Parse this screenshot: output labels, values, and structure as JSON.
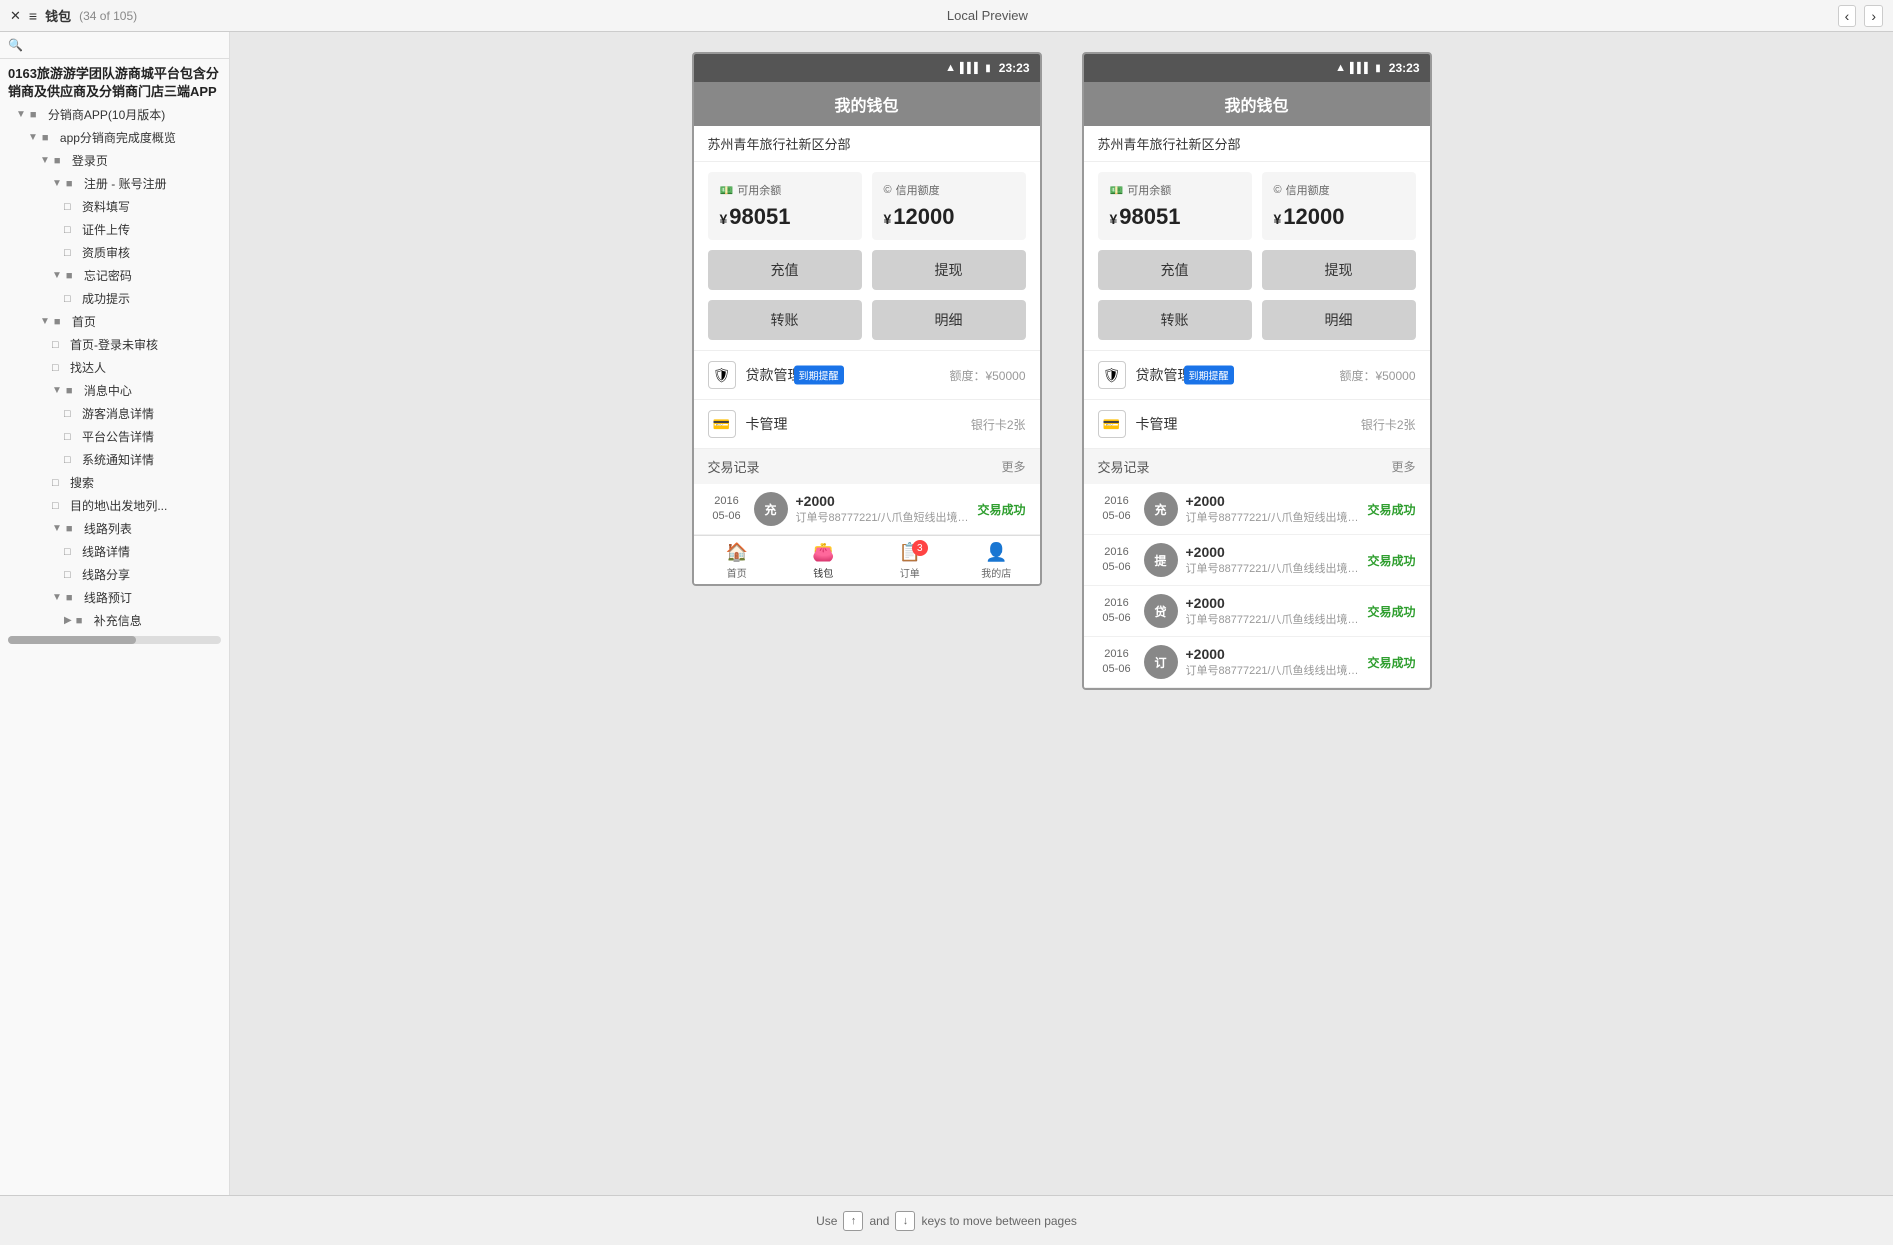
{
  "topBar": {
    "icon": "≡",
    "title": "钱包",
    "count": "(34 of 105)",
    "previewLabel": "Local Preview",
    "navPrev": "‹",
    "navNext": "›"
  },
  "sidebar": {
    "searchPlaceholder": "",
    "headerText": "0163旅游游学团队游商城平台包含分销商及供应商及分销商门店三端APP",
    "items": [
      {
        "level": 1,
        "type": "expand",
        "label": "分销商APP(10月版本)",
        "hasArrow": true
      },
      {
        "level": 2,
        "type": "expand",
        "label": "app分销商完成度概览",
        "hasArrow": true
      },
      {
        "level": 3,
        "type": "expand",
        "label": "登录页",
        "hasArrow": true
      },
      {
        "level": 4,
        "type": "expand",
        "label": "注册 - 账号注册",
        "hasArrow": true
      },
      {
        "level": 5,
        "type": "item",
        "label": "资料填写"
      },
      {
        "level": 5,
        "type": "item",
        "label": "证件上传"
      },
      {
        "level": 5,
        "type": "item",
        "label": "资质审核"
      },
      {
        "level": 4,
        "type": "expand",
        "label": "忘记密码",
        "hasArrow": true
      },
      {
        "level": 5,
        "type": "item",
        "label": "成功提示"
      },
      {
        "level": 3,
        "type": "expand",
        "label": "首页",
        "hasArrow": true
      },
      {
        "level": 4,
        "type": "item",
        "label": "首页-登录未审核"
      },
      {
        "level": 4,
        "type": "item",
        "label": "找达人"
      },
      {
        "level": 4,
        "type": "expand",
        "label": "消息中心",
        "hasArrow": true
      },
      {
        "level": 5,
        "type": "item",
        "label": "游客消息详情"
      },
      {
        "level": 5,
        "type": "item",
        "label": "平台公告详情"
      },
      {
        "level": 5,
        "type": "item",
        "label": "系统通知详情"
      },
      {
        "level": 4,
        "type": "item",
        "label": "搜索"
      },
      {
        "level": 4,
        "type": "item",
        "label": "目的地\\出发地列..."
      },
      {
        "level": 4,
        "type": "expand",
        "label": "线路列表",
        "hasArrow": true
      },
      {
        "level": 5,
        "type": "item",
        "label": "线路详情"
      },
      {
        "level": 5,
        "type": "item",
        "label": "线路分享"
      },
      {
        "level": 4,
        "type": "expand",
        "label": "线路预订",
        "hasArrow": true
      },
      {
        "level": 5,
        "type": "expand",
        "label": "补充信息",
        "hasArrow": true
      }
    ]
  },
  "phoneLeft": {
    "statusBar": {
      "wifi": "wifi",
      "signal": "signal",
      "battery": "battery",
      "time": "23:23"
    },
    "header": "我的钱包",
    "agencyName": "苏州青年旅行社新区分部",
    "balances": [
      {
        "icon": "💵",
        "title": "可用余额",
        "amount": "98051"
      },
      {
        "icon": "💳",
        "title": "信用额度",
        "amount": "12000"
      }
    ],
    "actionRow1": [
      {
        "label": "充值"
      },
      {
        "label": "提现"
      }
    ],
    "actionRow2": [
      {
        "label": "转账"
      },
      {
        "label": "明细"
      }
    ],
    "menuItems": [
      {
        "icon": "🛡",
        "label": "贷款管理",
        "badge": "到期提醒",
        "right": "额度：¥50000"
      },
      {
        "icon": "💳",
        "label": "卡管理",
        "badge": null,
        "right": "银行卡2张"
      }
    ],
    "txHeader": {
      "title": "交易记录",
      "more": "更多"
    },
    "transactions": [
      {
        "year": "2016",
        "date": "05-06",
        "circleLabel": "充",
        "amount": "+2000",
        "desc": "订单号88777221/八爪鱼短线出境订单...",
        "status": "交易成功"
      },
      {
        "year": "",
        "date": "",
        "circleLabel": "",
        "amount": "",
        "desc": "",
        "status": ""
      }
    ],
    "bottomNav": [
      {
        "icon": "🏠",
        "label": "首页",
        "active": false,
        "badge": null
      },
      {
        "icon": "👛",
        "label": "钱包",
        "active": true,
        "badge": null
      },
      {
        "icon": "📋",
        "label": "订单",
        "active": false,
        "badge": "3"
      },
      {
        "icon": "👤",
        "label": "我的店",
        "active": false,
        "badge": null
      }
    ]
  },
  "phoneRight": {
    "statusBar": {
      "wifi": "wifi",
      "signal": "signal",
      "battery": "battery",
      "time": "23:23"
    },
    "header": "我的钱包",
    "agencyName": "苏州青年旅行社新区分部",
    "balances": [
      {
        "icon": "💵",
        "title": "可用余额",
        "amount": "98051"
      },
      {
        "icon": "💳",
        "title": "信用额度",
        "amount": "12000"
      }
    ],
    "actionRow1": [
      {
        "label": "充值"
      },
      {
        "label": "提现"
      }
    ],
    "actionRow2": [
      {
        "label": "转账"
      },
      {
        "label": "明细"
      }
    ],
    "menuItems": [
      {
        "icon": "🛡",
        "label": "贷款管理",
        "badge": "到期提醒",
        "right": "额度：¥50000"
      },
      {
        "icon": "💳",
        "label": "卡管理",
        "badge": null,
        "right": "银行卡2张"
      }
    ],
    "txHeader": {
      "title": "交易记录",
      "more": "更多"
    },
    "transactions": [
      {
        "year": "2016",
        "date": "05-06",
        "circleLabel": "充",
        "circleColor": "#888",
        "amount": "+2000",
        "desc": "订单号88777221/八爪鱼短线出境订单...",
        "status": "交易成功"
      },
      {
        "year": "2016",
        "date": "05-06",
        "circleLabel": "提",
        "circleColor": "#888",
        "amount": "+2000",
        "desc": "订单号88777221/八爪鱼线线出境订单...",
        "status": "交易成功"
      },
      {
        "year": "2016",
        "date": "05-06",
        "circleLabel": "贷",
        "circleColor": "#888",
        "amount": "+2000",
        "desc": "订单号88777221/八爪鱼线线出境订单...",
        "status": "交易成功"
      },
      {
        "year": "2016",
        "date": "05-06",
        "circleLabel": "订",
        "circleColor": "#888",
        "amount": "+2000",
        "desc": "订单号88777221/八爪鱼线线出境订单...",
        "status": "交易成功"
      }
    ]
  },
  "bottomHint": {
    "text1": "Use",
    "key1": "↑",
    "text2": "and",
    "key2": "↓",
    "text3": "keys",
    "line2": "to move between pages"
  }
}
